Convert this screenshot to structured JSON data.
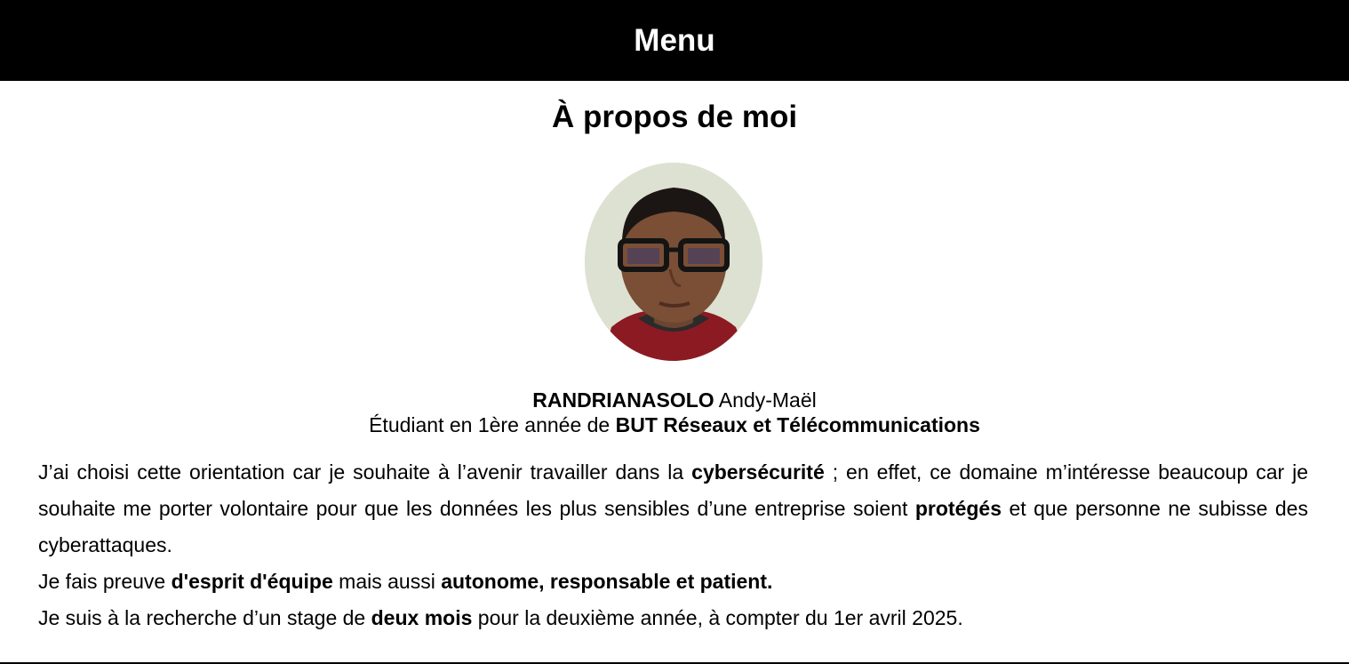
{
  "header": {
    "menu_label": "Menu"
  },
  "about": {
    "title": "À propos de moi",
    "avatar_icon": "profile-photo",
    "last_name": "RANDRIANASOLO",
    "first_name": " Andy-Maël",
    "study_prefix": "Étudiant en 1ère année de ",
    "study_program": "BUT Réseaux et Télécommunications",
    "p1_a": "J’ai choisi cette orientation car je souhaite à l’avenir travailler dans la ",
    "p1_b": "cybersécurité",
    "p1_c": " ; en effet, ce domaine m’intéresse beaucoup car je souhaite me porter volontaire pour que les données les plus sensibles d’une entreprise soient ",
    "p1_d": "protégés",
    "p1_e": " et que personne ne subisse des cyberattaques.",
    "p2_a": "Je fais preuve ",
    "p2_b": "d'esprit d'équipe",
    "p2_c": " mais aussi ",
    "p2_d": "autonome, responsable et patient.",
    "p3_a": "Je suis à la recherche d’un stage de ",
    "p3_b": "deux mois",
    "p3_c": " pour la deuxième année, à compter du 1er avril 2025."
  },
  "colors": {
    "header_bg": "#000000",
    "header_text": "#ffffff",
    "page_bg": "#ffffff",
    "text": "#000000"
  }
}
